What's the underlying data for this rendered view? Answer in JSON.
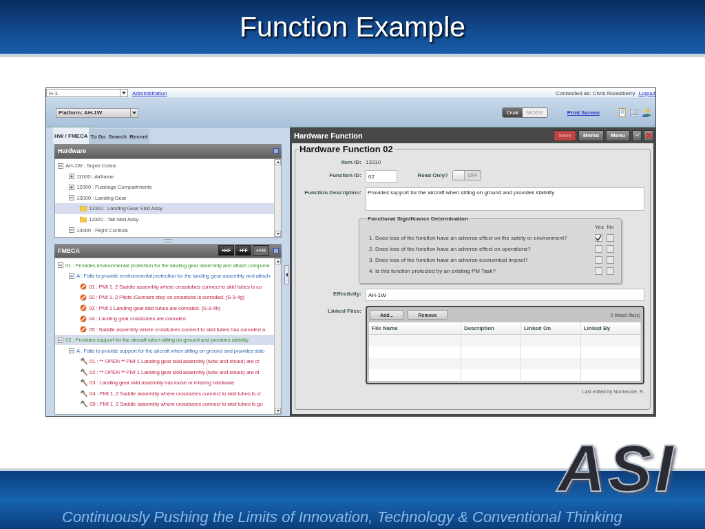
{
  "slide": {
    "title": "Function Example",
    "footer": "Continuously Pushing the Limits of  Innovation, Technology & Conventional Thinking",
    "logo": "ASI"
  },
  "app": {
    "top_bar": {
      "unit_select": "H-1",
      "admin_link": "Administration",
      "connected_as": "Connected as: Chris Rooksberry",
      "logout_link": "Logout"
    },
    "toolbar": {
      "platform_select": "Platform: AH-1W",
      "mode_toggle": [
        {
          "label": "Dual",
          "selected": true
        },
        {
          "label": "MODE",
          "selected": false
        }
      ],
      "print_link": "Print Screen"
    },
    "left_tabs": [
      {
        "label": "HW / FMECA",
        "selected": true
      },
      {
        "label": "To Do",
        "selected": false
      },
      {
        "label": "Search",
        "selected": false
      },
      {
        "label": "Recent",
        "selected": false
      }
    ],
    "hardware": {
      "title": "Hardware",
      "tree": [
        {
          "kind": "group",
          "label": "AH-1W : Super Cobra",
          "expanded": true,
          "selected": false,
          "children": [
            {
              "kind": "group",
              "label": "11000 : Airframe",
              "expanded": false,
              "selected": false
            },
            {
              "kind": "group",
              "label": "12000 : Fuselage Compartments",
              "expanded": false,
              "selected": false
            },
            {
              "kind": "group",
              "label": "13000 : Landing Gear",
              "expanded": true,
              "selected": false,
              "children": [
                {
                  "kind": "item",
                  "label": "13310 : Landing Gear Skid Assy",
                  "selected": true
                },
                {
                  "kind": "item",
                  "label": "13320 : Tail Skid Assy",
                  "selected": false
                }
              ]
            },
            {
              "kind": "group",
              "label": "14000 : Flight Controls",
              "expanded": true,
              "selected": false
            }
          ]
        }
      ]
    },
    "fmeca": {
      "title": "FMECA",
      "buttons": [
        {
          "label": "+HF",
          "disabled": false
        },
        {
          "label": "+FF",
          "disabled": false
        },
        {
          "label": "+FM",
          "disabled": true
        }
      ],
      "tree": [
        {
          "kind": "function",
          "label": "01 : Provides environmental protection for the landing gear assembly and attach compone",
          "expanded": true,
          "selected": false,
          "children": [
            {
              "kind": "failure",
              "label": "A : Fails to provide environmental protection for the landing gear assembly and attach",
              "expanded": true,
              "selected": false,
              "children": [
                {
                  "kind": "effect",
                  "label": "01 : PMI 1, 2  Saddle assembly where crosstubes connect to skid tubes is co",
                  "selected": false
                },
                {
                  "kind": "effect",
                  "label": "02 : PMI 1, 2  Pilots /Gunners step on crosstube is corroded.  (S-3-4g)",
                  "selected": false
                },
                {
                  "kind": "effect",
                  "label": "03 : PMI 1  Landing gear skid tubes are corroded.  (S-3-4b)",
                  "selected": false
                },
                {
                  "kind": "effect",
                  "label": "04 : Landing gear crosstubes are corroded.",
                  "selected": false
                },
                {
                  "kind": "effect",
                  "label": "05 : Saddle assembly where crosstubes connect to skid tubes has corroded a",
                  "selected": false
                }
              ]
            }
          ]
        },
        {
          "kind": "function",
          "label": "02 : Provides support for the aircraft when sitting on ground and provides stability",
          "expanded": true,
          "selected": true,
          "children": [
            {
              "kind": "failure",
              "label": "A : Fails to provide support for the aircraft when sitting on ground and provides stab",
              "expanded": true,
              "selected": false,
              "children": [
                {
                  "kind": "task",
                  "label": "01 : ** OPEN  **  PMI 1  Landing gear skid assembly (tube and shoes) are cr",
                  "selected": false
                },
                {
                  "kind": "task",
                  "label": "02 : **  OPEN  **  PMI 1  Landing gear skid assembly (tube and shoes) are di",
                  "selected": false
                },
                {
                  "kind": "task",
                  "label": "03 : Landing gear skid assembly has loose or missing hardware",
                  "selected": false
                },
                {
                  "kind": "task",
                  "label": "04 : PMI 1, 2  Saddle assembly where crosstubes connect to skid tubes is cr",
                  "selected": false
                },
                {
                  "kind": "task",
                  "label": "05 : PMI 1, 2  Saddle assembly where crosstubes connect to skid tubes is go",
                  "selected": false
                }
              ]
            }
          ]
        }
      ]
    },
    "form": {
      "panel_title": "Hardware Function",
      "buttons": [
        {
          "label": "Save",
          "disabled": true
        },
        {
          "label": "Memo",
          "disabled": false
        },
        {
          "label": "Menu",
          "disabled": false
        }
      ],
      "legend": "Hardware Function 02",
      "item_id": {
        "label": "Item ID:",
        "value": "13310"
      },
      "function_id": {
        "label": "Function ID:",
        "value": "02"
      },
      "read_only": {
        "label": "Read Only?",
        "on": false,
        "text": "OFF"
      },
      "description": {
        "label": "Function Description:",
        "value": "Provides support for the aircraft when sitting on ground and provides stability"
      },
      "fsd": {
        "legend": "Functional Significance Determination",
        "yes": "Yes",
        "no": "No",
        "questions": [
          {
            "text": "1. Does loss of the function have an adverse effect on the safety or environment?",
            "yes": true,
            "no": false
          },
          {
            "text": "2. Does loss of the function have an adverse effect on operations?",
            "yes": false,
            "no": false
          },
          {
            "text": "3. Does loss of the function have an adverse economical impact?",
            "yes": false,
            "no": false
          },
          {
            "text": "4. Is this function protected by an existing PM Task?",
            "yes": false,
            "no": false
          }
        ]
      },
      "effectivity": {
        "label": "Effectivity:",
        "value": "AH-1W"
      },
      "linked_files": {
        "label": "Linked Files:",
        "add": "Add...",
        "remove": "Remove",
        "count": "0 linked file(s)",
        "columns": [
          "File Name",
          "Description",
          "Linked On",
          "Linked By"
        ]
      },
      "last_edited": "Last edited by Northecide, R."
    }
  }
}
